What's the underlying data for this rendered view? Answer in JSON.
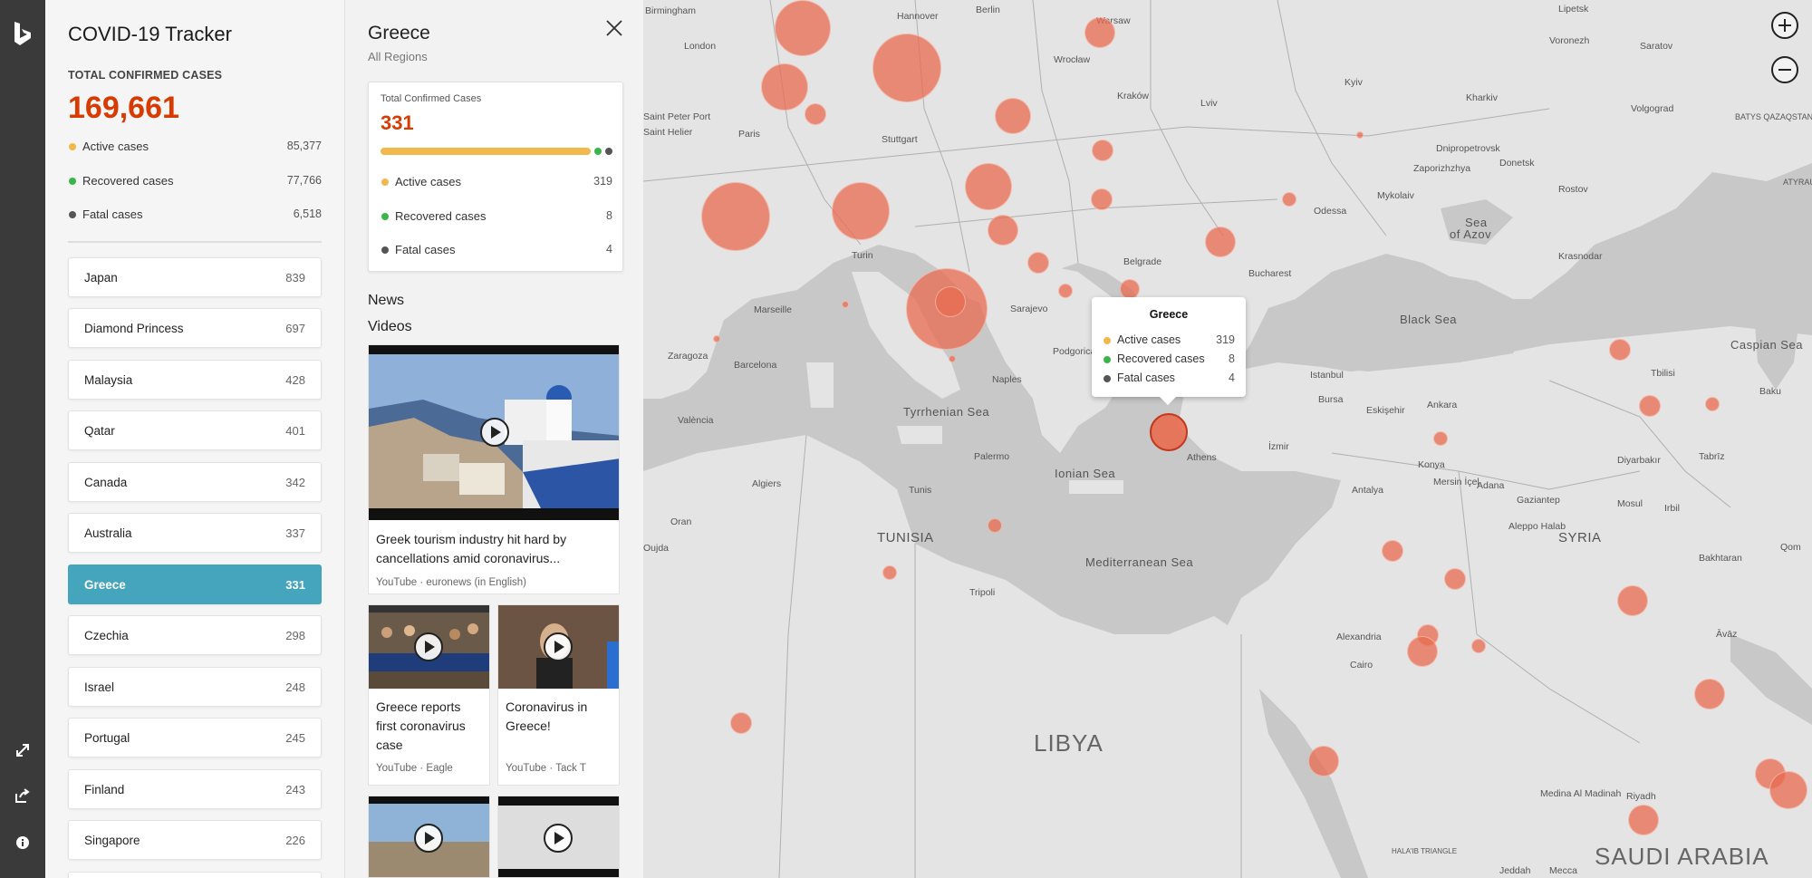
{
  "colors": {
    "active": "#f2b84b",
    "recovered": "#3ab54a",
    "fatal": "#555555",
    "accent": "#d83b01",
    "selected": "#45a5bd",
    "bubble": "#e86b4f"
  },
  "rail": {
    "logo_icon": "bing-logo-icon",
    "buttons": [
      "expand-icon",
      "share-icon",
      "info-icon"
    ]
  },
  "tracker": {
    "title": "COVID-19 Tracker",
    "total_label": "TOTAL CONFIRMED CASES",
    "total_value": "169,661",
    "stats": [
      {
        "label": "Active cases",
        "value": "85,377"
      },
      {
        "label": "Recovered cases",
        "value": "77,766"
      },
      {
        "label": "Fatal cases",
        "value": "6,518"
      }
    ],
    "countries": [
      {
        "name": "Japan",
        "count": "839"
      },
      {
        "name": "Diamond Princess",
        "count": "697"
      },
      {
        "name": "Malaysia",
        "count": "428"
      },
      {
        "name": "Qatar",
        "count": "401"
      },
      {
        "name": "Canada",
        "count": "342"
      },
      {
        "name": "Australia",
        "count": "337"
      },
      {
        "name": "Greece",
        "count": "331"
      },
      {
        "name": "Czechia",
        "count": "298"
      },
      {
        "name": "Israel",
        "count": "248"
      },
      {
        "name": "Portugal",
        "count": "245"
      },
      {
        "name": "Finland",
        "count": "243"
      },
      {
        "name": "Singapore",
        "count": "226"
      }
    ],
    "selected_country": "Greece"
  },
  "detail": {
    "title": "Greece",
    "subtitle": "All Regions",
    "card": {
      "label": "Total Confirmed Cases",
      "value": "331",
      "active": 319,
      "recovered": 8,
      "fatal": 4,
      "stats": [
        {
          "label": "Active cases",
          "value": "319"
        },
        {
          "label": "Recovered cases",
          "value": "8"
        },
        {
          "label": "Fatal cases",
          "value": "4"
        }
      ]
    },
    "news_heading": "News",
    "videos_heading": "Videos",
    "videos": [
      {
        "title_line1": "Greek tourism industry hit hard by",
        "title_line2": "cancellations amid coronavirus...",
        "meta": "YouTube · euronews (in English)"
      },
      {
        "title_line1": "Greece reports",
        "title_line2": "first coronavirus",
        "title_line3": "case",
        "meta": "YouTube · Eagle"
      },
      {
        "title_line1": "Coronavirus in",
        "title_line2": "Greece!",
        "meta": "YouTube · Tack T"
      }
    ]
  },
  "map": {
    "tooltip": {
      "title": "Greece",
      "stats": [
        {
          "label": "Active cases",
          "value": "319"
        },
        {
          "label": "Recovered cases",
          "value": "8"
        },
        {
          "label": "Fatal cases",
          "value": "4"
        }
      ]
    },
    "labels": {
      "birmingham": "Birmingham",
      "london": "London",
      "stpeter": "Saint Peter Port",
      "sthelier": "Saint Helier",
      "paris": "Paris",
      "hannover": "Hannover",
      "berlin": "Berlin",
      "warsaw": "Warsaw",
      "wroclaw": "Wrocław",
      "krakow": "Kraków",
      "lviv": "Lviv",
      "kyiv": "Kyiv",
      "stuttgart": "Stuttgart",
      "turin": "Turin",
      "marseille": "Marseille",
      "zaragoza": "Zaragoza",
      "barcelona": "Barcelona",
      "valencia": "València",
      "algiers": "Algiers",
      "oran": "Oran",
      "oujda": "Oujda",
      "tunis": "Tunis",
      "tripoli": "Tripoli",
      "naples": "Naples",
      "palermo": "Palermo",
      "sarajevo": "Sarajevo",
      "podgorica": "Podgorica",
      "belgrade": "Belgrade",
      "bucharest": "Bucharest",
      "odessa": "Odessa",
      "mykolaiv": "Mykolaiv",
      "dnipro": "Dnipropetrovsk",
      "zaporizhzhya": "Zaporizhzhya",
      "donetsk": "Donetsk",
      "rostov": "Rostov",
      "volgograd": "Volgograd",
      "saratov": "Saratov",
      "lipetsk": "Lipetsk",
      "voronezh": "Voronezh",
      "kharkiv": "Kharkiv",
      "krasnodar": "Krasnodar",
      "istanbul": "Istanbul",
      "bursa": "Bursa",
      "eskisehir": "Eskişehir",
      "ankara": "Ankara",
      "izmir": "İzmir",
      "athens": "Athens",
      "konya": "Konya",
      "antalya": "Antalya",
      "mersin": "Mersin İçel",
      "adana": "Adana",
      "gaziantep": "Gaziantep",
      "aleppo": "Aleppo Halab",
      "diyarbakir": "Diyarbakır",
      "mosul": "Mosul",
      "irbil": "Irbil",
      "tabriz": "Tabrīz",
      "tbilisi": "Tbilisi",
      "baku": "Baku",
      "qom": "Qom",
      "bakhtaran": "Bakhtaran",
      "ahvaz": "Āvāz",
      "alexandria": "Alexandria",
      "cairo": "Cairo",
      "madinah": "Medina Al Madinah",
      "riyadh": "Riyadh",
      "jeddah": "Jeddah",
      "mecca": "Mecca",
      "halaib": "HALA'IB TRIANGLE",
      "atyrau": "ATYRAU",
      "batys": "BATYS QAZAQSTAN"
    },
    "seas": {
      "black_sea": "Black Sea",
      "sea_azov_1": "Sea",
      "sea_azov_2": "of Azov",
      "caspian": "Caspian Sea",
      "tyrrhenian": "Tyrrhenian Sea",
      "ionian": "Ionian Sea",
      "med": "Mediterranean Sea"
    },
    "countries": {
      "tunisia": "TUNISIA",
      "syria": "SYRIA",
      "libya": "LIBYA",
      "saudi": "SAUDI ARABIA"
    },
    "zoom_in_icon": "plus-circle-icon",
    "zoom_out_icon": "minus-circle-icon"
  }
}
